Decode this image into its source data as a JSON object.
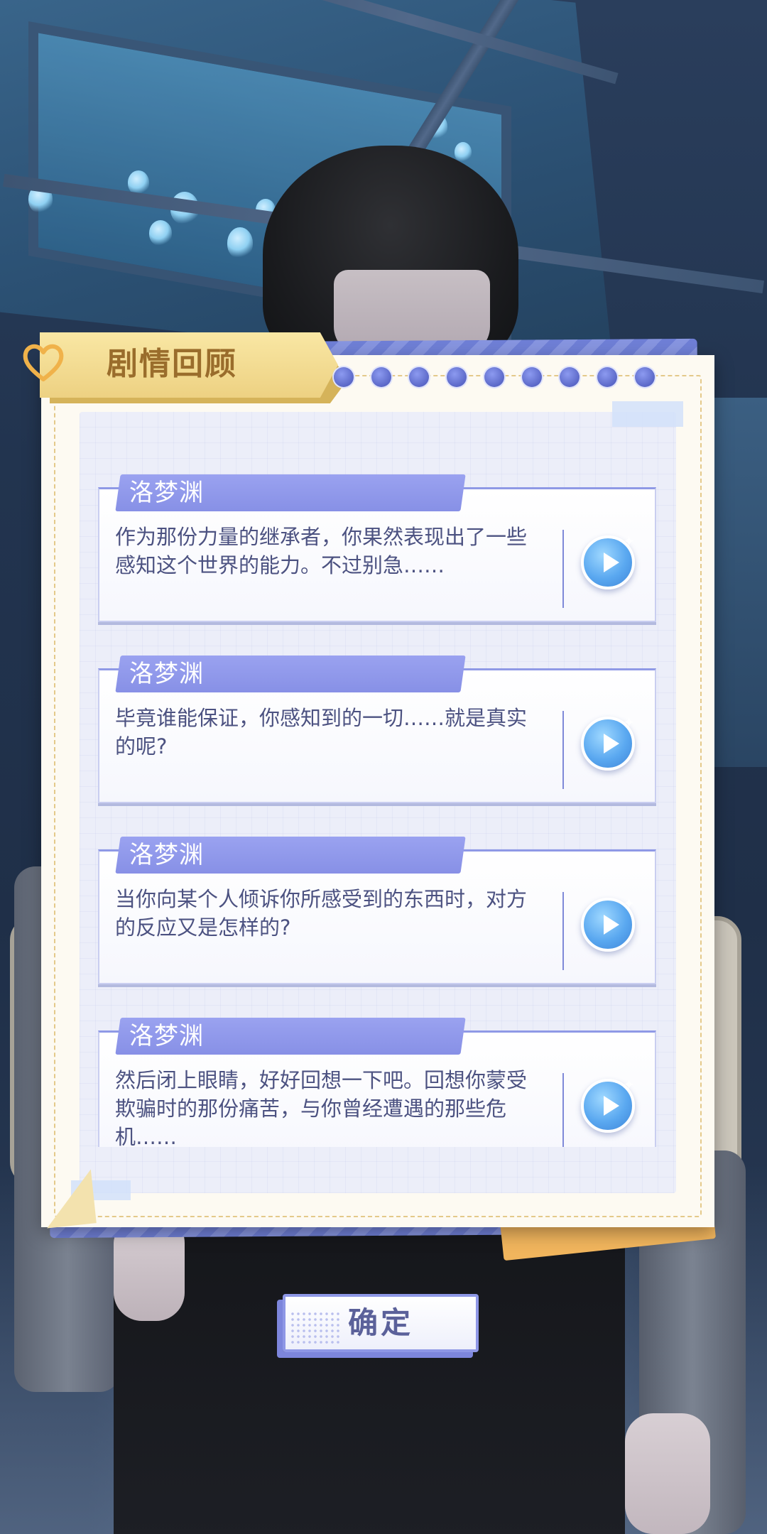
{
  "dialog": {
    "title": "剧情回顾",
    "confirm_label": "确定"
  },
  "entries": [
    {
      "speaker": "洛梦渊",
      "text": "作为那份力量的继承者，你果然表现出了一些感知这个世界的能力。不过别急……"
    },
    {
      "speaker": "洛梦渊",
      "text": "毕竟谁能保证，你感知到的一切……就是真实的呢?"
    },
    {
      "speaker": "洛梦渊",
      "text": "当你向某个人倾诉你所感受到的东西时，对方的反应又是怎样的?"
    },
    {
      "speaker": "洛梦渊",
      "text": "然后闭上眼睛，好好回想一下吧。回想你蒙受欺骗时的那份痛苦，与你曾经遭遇的那些危机……"
    }
  ],
  "icons": {
    "play": "play-icon",
    "heart": "heart-icon",
    "sparkle": "sparkle-icon"
  },
  "colors": {
    "accent": "#8790e6",
    "ribbon": "#edd182",
    "text": "#4c5281"
  }
}
